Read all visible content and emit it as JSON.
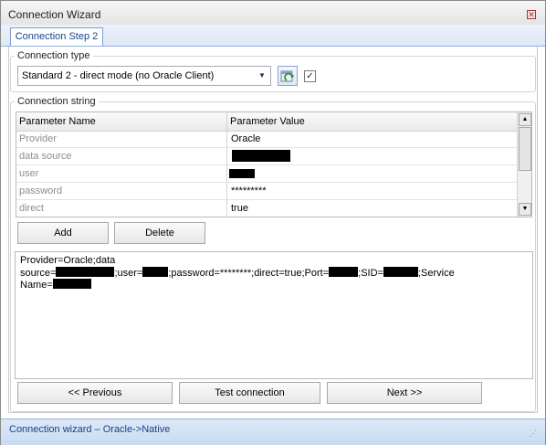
{
  "window": {
    "title": "Connection Wizard",
    "close_glyph": "✕"
  },
  "tabs": [
    {
      "label": "Connection Step 2"
    }
  ],
  "connection_type": {
    "legend": "Connection type",
    "selected": "Standard 2 - direct mode (no Oracle Client)",
    "dropdown_icon": "chevron-down-icon",
    "checkbox_checked": true,
    "checkbox_glyph": "✓"
  },
  "connection_string": {
    "legend": "Connection string",
    "grid": {
      "headers": [
        "Parameter Name",
        "Parameter Value"
      ],
      "rows": [
        {
          "name": "Provider",
          "value": "Oracle"
        },
        {
          "name": "data source",
          "value": ""
        },
        {
          "name": "user",
          "value": ""
        },
        {
          "name": "password",
          "value": "*********"
        },
        {
          "name": "direct",
          "value": "true"
        }
      ]
    },
    "add_label": "Add",
    "delete_label": "Delete",
    "text": {
      "line1": "Provider=Oracle;data",
      "line2_source": "source=",
      "line2_user": ";user=",
      "line2_password": ";password=********;direct=true;Port=",
      "line2_sid": ";SID=",
      "line2_service": ";Service",
      "line3": "Name="
    }
  },
  "nav": {
    "previous": "<< Previous",
    "test": "Test connection",
    "next": "Next >>"
  },
  "status": {
    "text": "Connection  wizard  –  Oracle->Native",
    "grip_glyph": "⋰"
  },
  "colors": {
    "accent": "#15428b",
    "status_bg": "#c9dbf2"
  }
}
